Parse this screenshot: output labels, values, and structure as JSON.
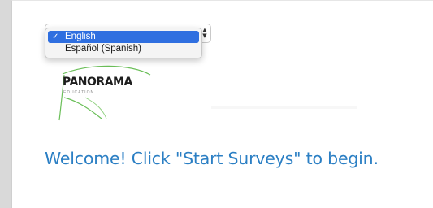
{
  "language_select": {
    "selected": "English",
    "options": [
      {
        "label": "English",
        "selected": true
      },
      {
        "label": "Español (Spanish)",
        "selected": false
      }
    ]
  },
  "logo": {
    "name": "PANORAMA",
    "tagline": "EDUCATION"
  },
  "welcome": {
    "message": "Welcome! Click \"Start Surveys\" to begin."
  },
  "colors": {
    "accent": "#2b7fc4",
    "selection": "#2f6fe0",
    "logo_swoosh": "#6bbf59"
  },
  "icons": {
    "check": "check-icon",
    "select_arrows": "updown-arrows-icon"
  }
}
